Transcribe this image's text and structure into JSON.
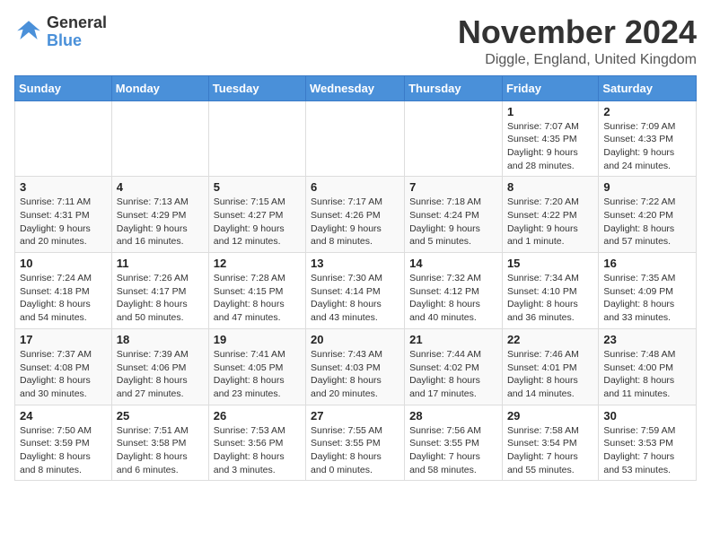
{
  "logo": {
    "line1": "General",
    "line2": "Blue"
  },
  "title": "November 2024",
  "location": "Diggle, England, United Kingdom",
  "days_of_week": [
    "Sunday",
    "Monday",
    "Tuesday",
    "Wednesday",
    "Thursday",
    "Friday",
    "Saturday"
  ],
  "weeks": [
    [
      {
        "day": "",
        "info": ""
      },
      {
        "day": "",
        "info": ""
      },
      {
        "day": "",
        "info": ""
      },
      {
        "day": "",
        "info": ""
      },
      {
        "day": "",
        "info": ""
      },
      {
        "day": "1",
        "info": "Sunrise: 7:07 AM\nSunset: 4:35 PM\nDaylight: 9 hours and 28 minutes."
      },
      {
        "day": "2",
        "info": "Sunrise: 7:09 AM\nSunset: 4:33 PM\nDaylight: 9 hours and 24 minutes."
      }
    ],
    [
      {
        "day": "3",
        "info": "Sunrise: 7:11 AM\nSunset: 4:31 PM\nDaylight: 9 hours and 20 minutes."
      },
      {
        "day": "4",
        "info": "Sunrise: 7:13 AM\nSunset: 4:29 PM\nDaylight: 9 hours and 16 minutes."
      },
      {
        "day": "5",
        "info": "Sunrise: 7:15 AM\nSunset: 4:27 PM\nDaylight: 9 hours and 12 minutes."
      },
      {
        "day": "6",
        "info": "Sunrise: 7:17 AM\nSunset: 4:26 PM\nDaylight: 9 hours and 8 minutes."
      },
      {
        "day": "7",
        "info": "Sunrise: 7:18 AM\nSunset: 4:24 PM\nDaylight: 9 hours and 5 minutes."
      },
      {
        "day": "8",
        "info": "Sunrise: 7:20 AM\nSunset: 4:22 PM\nDaylight: 9 hours and 1 minute."
      },
      {
        "day": "9",
        "info": "Sunrise: 7:22 AM\nSunset: 4:20 PM\nDaylight: 8 hours and 57 minutes."
      }
    ],
    [
      {
        "day": "10",
        "info": "Sunrise: 7:24 AM\nSunset: 4:18 PM\nDaylight: 8 hours and 54 minutes."
      },
      {
        "day": "11",
        "info": "Sunrise: 7:26 AM\nSunset: 4:17 PM\nDaylight: 8 hours and 50 minutes."
      },
      {
        "day": "12",
        "info": "Sunrise: 7:28 AM\nSunset: 4:15 PM\nDaylight: 8 hours and 47 minutes."
      },
      {
        "day": "13",
        "info": "Sunrise: 7:30 AM\nSunset: 4:14 PM\nDaylight: 8 hours and 43 minutes."
      },
      {
        "day": "14",
        "info": "Sunrise: 7:32 AM\nSunset: 4:12 PM\nDaylight: 8 hours and 40 minutes."
      },
      {
        "day": "15",
        "info": "Sunrise: 7:34 AM\nSunset: 4:10 PM\nDaylight: 8 hours and 36 minutes."
      },
      {
        "day": "16",
        "info": "Sunrise: 7:35 AM\nSunset: 4:09 PM\nDaylight: 8 hours and 33 minutes."
      }
    ],
    [
      {
        "day": "17",
        "info": "Sunrise: 7:37 AM\nSunset: 4:08 PM\nDaylight: 8 hours and 30 minutes."
      },
      {
        "day": "18",
        "info": "Sunrise: 7:39 AM\nSunset: 4:06 PM\nDaylight: 8 hours and 27 minutes."
      },
      {
        "day": "19",
        "info": "Sunrise: 7:41 AM\nSunset: 4:05 PM\nDaylight: 8 hours and 23 minutes."
      },
      {
        "day": "20",
        "info": "Sunrise: 7:43 AM\nSunset: 4:03 PM\nDaylight: 8 hours and 20 minutes."
      },
      {
        "day": "21",
        "info": "Sunrise: 7:44 AM\nSunset: 4:02 PM\nDaylight: 8 hours and 17 minutes."
      },
      {
        "day": "22",
        "info": "Sunrise: 7:46 AM\nSunset: 4:01 PM\nDaylight: 8 hours and 14 minutes."
      },
      {
        "day": "23",
        "info": "Sunrise: 7:48 AM\nSunset: 4:00 PM\nDaylight: 8 hours and 11 minutes."
      }
    ],
    [
      {
        "day": "24",
        "info": "Sunrise: 7:50 AM\nSunset: 3:59 PM\nDaylight: 8 hours and 8 minutes."
      },
      {
        "day": "25",
        "info": "Sunrise: 7:51 AM\nSunset: 3:58 PM\nDaylight: 8 hours and 6 minutes."
      },
      {
        "day": "26",
        "info": "Sunrise: 7:53 AM\nSunset: 3:56 PM\nDaylight: 8 hours and 3 minutes."
      },
      {
        "day": "27",
        "info": "Sunrise: 7:55 AM\nSunset: 3:55 PM\nDaylight: 8 hours and 0 minutes."
      },
      {
        "day": "28",
        "info": "Sunrise: 7:56 AM\nSunset: 3:55 PM\nDaylight: 7 hours and 58 minutes."
      },
      {
        "day": "29",
        "info": "Sunrise: 7:58 AM\nSunset: 3:54 PM\nDaylight: 7 hours and 55 minutes."
      },
      {
        "day": "30",
        "info": "Sunrise: 7:59 AM\nSunset: 3:53 PM\nDaylight: 7 hours and 53 minutes."
      }
    ]
  ]
}
